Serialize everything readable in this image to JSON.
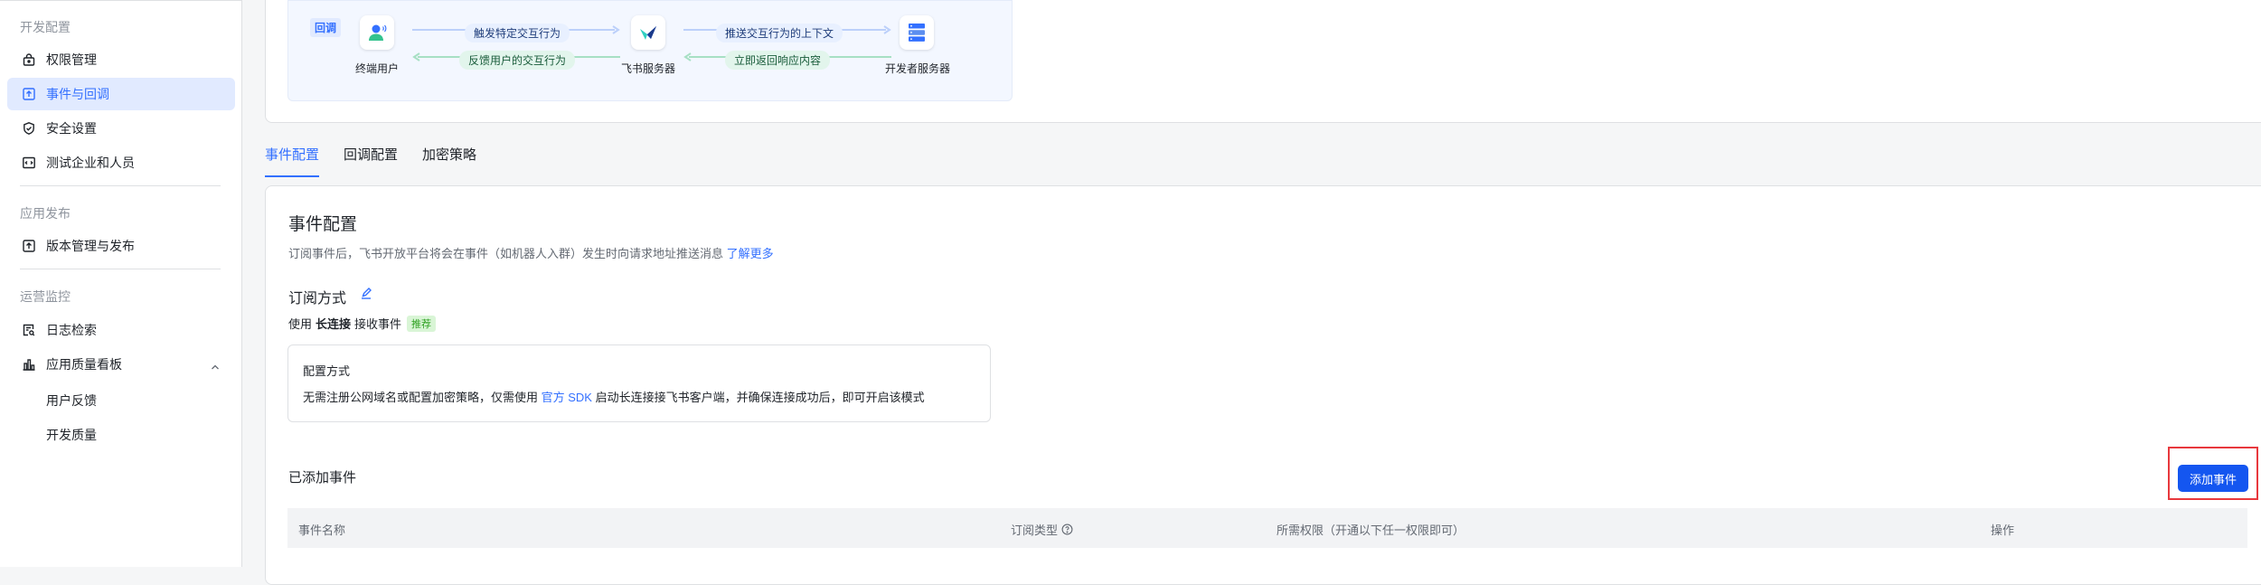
{
  "sidebar": {
    "sections": [
      {
        "title": "开发配置"
      },
      {
        "title": "应用发布"
      },
      {
        "title": "运营监控"
      }
    ],
    "items": [
      {
        "label": "权限管理",
        "icon": "lock-icon"
      },
      {
        "label": "事件与回调",
        "icon": "event-callback-icon",
        "active": true
      },
      {
        "label": "安全设置",
        "icon": "shield-icon"
      },
      {
        "label": "测试企业和人员",
        "icon": "code-user-icon"
      },
      {
        "label": "版本管理与发布",
        "icon": "upload-icon"
      },
      {
        "label": "日志检索",
        "icon": "log-search-icon"
      },
      {
        "label": "应用质量看板",
        "icon": "bar-chart-icon",
        "expanded": true
      }
    ],
    "subitems": [
      {
        "label": "用户反馈"
      },
      {
        "label": "开发质量"
      }
    ]
  },
  "flow": {
    "callback_tag": "回调",
    "end_user": "终端用户",
    "feishu_server": "飞书服务器",
    "dev_server": "开发者服务器",
    "trigger": "触发特定交互行为",
    "feedback": "反馈用户的交互行为",
    "push_context": "推送交互行为的上下文",
    "return_response": "立即返回响应内容"
  },
  "tabs": [
    {
      "label": "事件配置",
      "active": true
    },
    {
      "label": "回调配置"
    },
    {
      "label": "加密策略"
    }
  ],
  "event_config": {
    "title": "事件配置",
    "desc": "订阅事件后，飞书开放平台将会在事件（如机器人入群）发生时向请求地址推送消息",
    "learn_more": "了解更多",
    "subscribe_title": "订阅方式",
    "use_prefix": "使用",
    "use_bold": "长连接",
    "use_suffix": "接收事件",
    "recommend": "推荐",
    "mode_title": "配置方式",
    "mode_desc_pre": "无需注册公网域名或配置加密策略，仅需使用",
    "mode_desc_link": "官方 SDK",
    "mode_desc_post": "启动长连接接飞书客户端，并确保连接成功后，即可开启该模式",
    "added_title": "已添加事件",
    "add_button": "添加事件"
  },
  "table": {
    "headers": [
      "事件名称",
      "订阅类型",
      "所需权限（开通以下任一权限即可）",
      "操作"
    ]
  },
  "colors": {
    "accent": "#3370ff",
    "primary_button": "#1456f0",
    "highlight": "#e8383d",
    "active_nav_bg": "#e1eaff"
  }
}
